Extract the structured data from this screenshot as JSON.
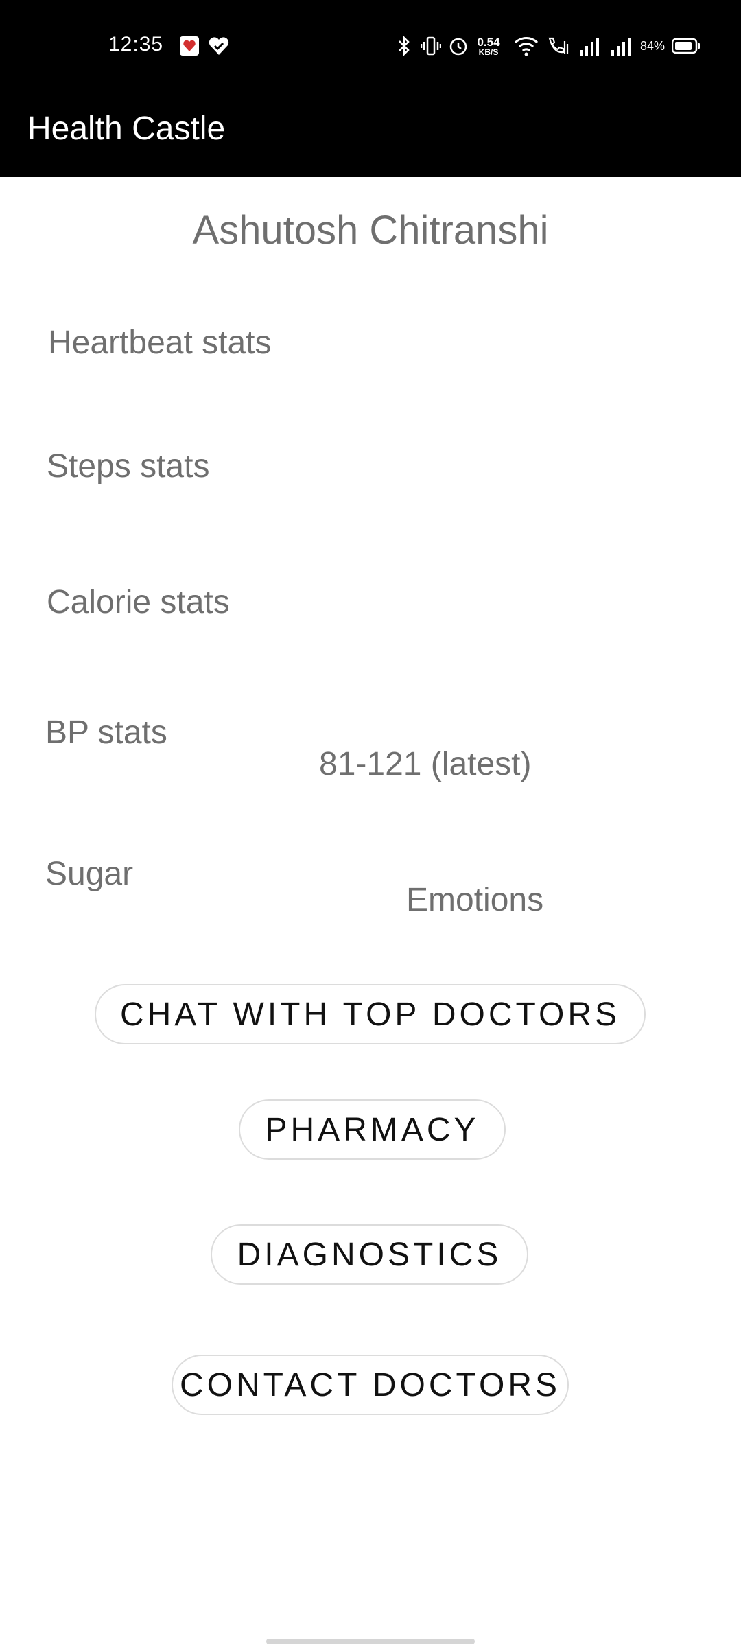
{
  "status_bar": {
    "time": "12:35",
    "net_speed_value": "0.54",
    "net_speed_unit": "KB/S",
    "battery": "84%"
  },
  "app_bar": {
    "title": "Health Castle"
  },
  "profile": {
    "name": "Ashutosh Chitranshi"
  },
  "stats": {
    "heartbeat": "Heartbeat stats",
    "steps": "Steps stats",
    "calorie": "Calorie stats",
    "bp": "BP stats",
    "bp_value": "81-121 (latest)",
    "sugar": "Sugar",
    "emotions": "Emotions"
  },
  "actions": {
    "chat": "CHAT WITH TOP DOCTORS",
    "pharmacy": "PHARMACY",
    "diagnostics": "DIAGNOSTICS",
    "contact": "CONTACT DOCTORS"
  }
}
